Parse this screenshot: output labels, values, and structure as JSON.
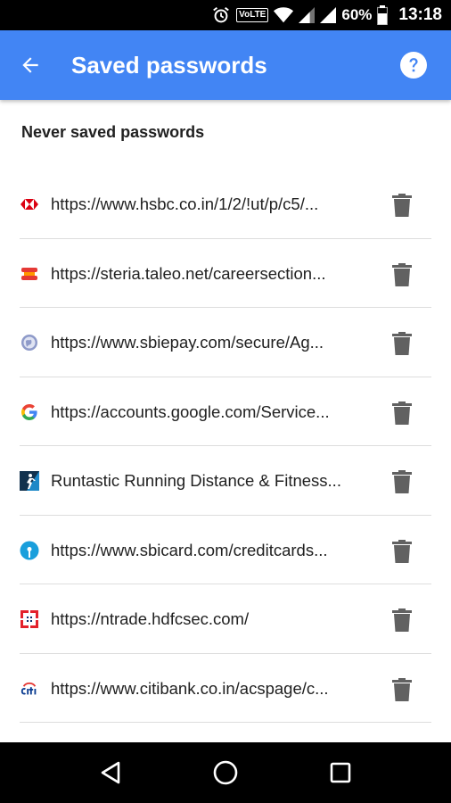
{
  "status_bar": {
    "volte": "VoLTE",
    "battery_percent": "60%",
    "time": "13:18",
    "icons": [
      "alarm-icon",
      "wifi-icon",
      "signal-icon",
      "signal-icon",
      "battery-icon"
    ]
  },
  "app_bar": {
    "title": "Saved passwords",
    "back_icon": "arrow-back-icon",
    "help_icon": "help-icon",
    "color": "#4285f4"
  },
  "section": {
    "header": "Never saved passwords"
  },
  "entries": [
    {
      "url": "https://www.hsbc.co.in/1/2/!ut/p/c5/...",
      "icon": "hsbc-favicon"
    },
    {
      "url": "https://steria.taleo.net/careersection...",
      "icon": "taleo-favicon"
    },
    {
      "url": "https://www.sbiepay.com/secure/Ag...",
      "icon": "globe-icon"
    },
    {
      "url": "https://accounts.google.com/Service...",
      "icon": "google-favicon"
    },
    {
      "url": "Runtastic Running Distance & Fitness...",
      "icon": "runtastic-app-icon"
    },
    {
      "url": "https://www.sbicard.com/creditcards...",
      "icon": "sbi-favicon"
    },
    {
      "url": "https://ntrade.hdfcsec.com/",
      "icon": "hdfc-favicon"
    },
    {
      "url": "https://www.citibank.co.in/acspage/c...",
      "icon": "citi-favicon"
    }
  ],
  "delete_icon": "trash-icon",
  "nav_bar": {
    "buttons": [
      "back-triangle-icon",
      "home-circle-icon",
      "recents-square-icon"
    ]
  }
}
